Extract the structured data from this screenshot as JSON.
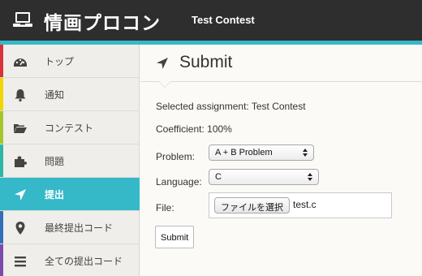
{
  "header": {
    "brand": "情画プロコン",
    "contest_name": "Test Contest",
    "logo_icon": "laptop-icon",
    "accent_color": "#35b9c9"
  },
  "sidebar": {
    "items": [
      {
        "label": "トップ",
        "icon": "dashboard-icon",
        "stripe": "#d9323a"
      },
      {
        "label": "通知",
        "icon": "bell-icon",
        "stripe": "#f1d500"
      },
      {
        "label": "コンテスト",
        "icon": "folder-open-icon",
        "stripe": "#a6c42b"
      },
      {
        "label": "問題",
        "icon": "puzzle-icon",
        "stripe": "#2eb6a5"
      },
      {
        "label": "提出",
        "icon": "location-arrow-icon",
        "stripe": "#35b9c9",
        "active": true
      },
      {
        "label": "最終提出コード",
        "icon": "map-marker-icon",
        "stripe": "#3170b8"
      },
      {
        "label": "全ての提出コード",
        "icon": "list-icon",
        "stripe": "#7a4ba8"
      }
    ]
  },
  "main": {
    "title": "Submit",
    "title_icon": "location-arrow-icon",
    "selected_assignment": "Selected assignment: Test Contest",
    "coefficient": "Coefficient: 100%",
    "problem_label": "Problem:",
    "problem_value": "A + B Problem",
    "language_label": "Language:",
    "language_value": "C",
    "file_label": "File:",
    "file_button": "ファイルを選択",
    "file_name": "test.c",
    "submit_label": "Submit"
  }
}
